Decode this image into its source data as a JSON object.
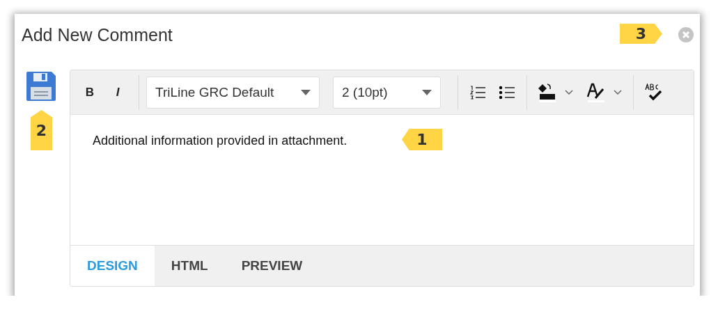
{
  "dialog": {
    "title": "Add New Comment"
  },
  "toolbar": {
    "bold": "B",
    "italic": "I",
    "font": "TriLine GRC Default",
    "size": "2 (10pt)"
  },
  "editor": {
    "text": "Additional information provided in attachment."
  },
  "tabs": [
    {
      "label": "DESIGN",
      "selected": true
    },
    {
      "label": "HTML",
      "selected": false
    },
    {
      "label": "PREVIEW",
      "selected": false
    }
  ],
  "callouts": [
    {
      "number": "3",
      "kind": "right"
    },
    {
      "number": "2",
      "kind": "up"
    },
    {
      "number": "1",
      "kind": "left"
    }
  ]
}
